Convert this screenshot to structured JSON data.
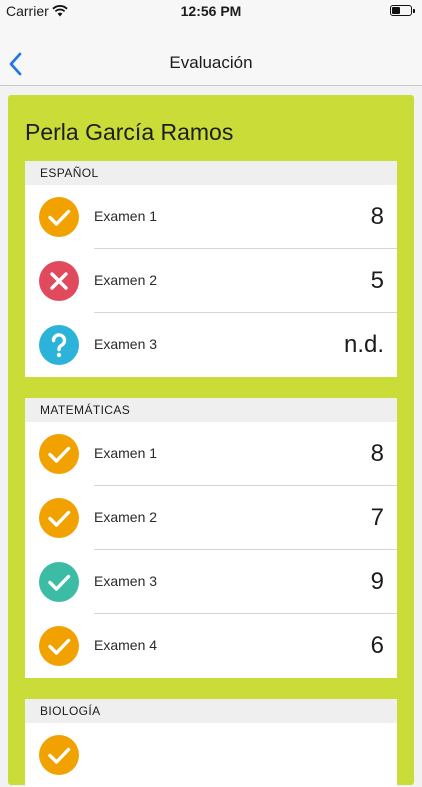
{
  "status_bar": {
    "carrier": "Carrier",
    "time": "12:56 PM"
  },
  "nav": {
    "title": "Evaluación",
    "back_icon": "chevron-left-icon"
  },
  "student": {
    "name": "Perla García Ramos"
  },
  "colors": {
    "card": "#cadc38",
    "passed": "#f2a200",
    "failed": "#e04a5c",
    "unknown": "#2bb3d9",
    "excellent": "#3cbca5",
    "nav_tint": "#1a7ae8"
  },
  "subjects": [
    {
      "name": "ESPAÑOL",
      "exams": [
        {
          "label": "Examen 1",
          "grade": "8",
          "icon": "check-icon",
          "color": "orange"
        },
        {
          "label": "Examen 2",
          "grade": "5",
          "icon": "x-icon",
          "color": "red"
        },
        {
          "label": "Examen 3",
          "grade": "n.d.",
          "icon": "question-icon",
          "color": "blue"
        }
      ]
    },
    {
      "name": "MATEMÁTICAS",
      "exams": [
        {
          "label": "Examen 1",
          "grade": "8",
          "icon": "check-icon",
          "color": "orange"
        },
        {
          "label": "Examen 2",
          "grade": "7",
          "icon": "check-icon",
          "color": "orange"
        },
        {
          "label": "Examen 3",
          "grade": "9",
          "icon": "check-icon",
          "color": "teal"
        },
        {
          "label": "Examen 4",
          "grade": "6",
          "icon": "check-icon",
          "color": "orange"
        }
      ]
    },
    {
      "name": "BIOLOGÍA",
      "exams": [
        {
          "label": "",
          "grade": "",
          "icon": "check-icon",
          "color": "orange"
        }
      ]
    }
  ]
}
